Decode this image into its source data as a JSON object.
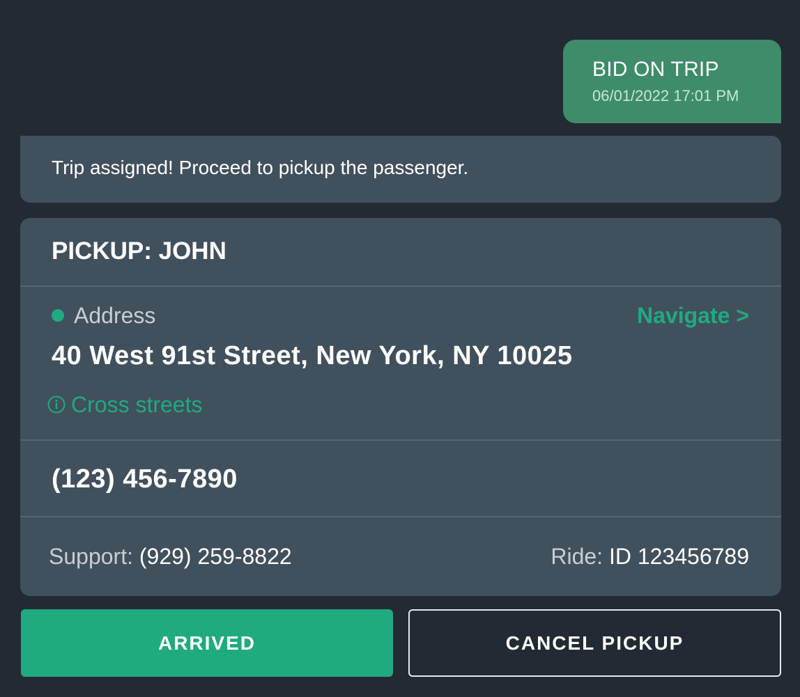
{
  "outgoing_message": {
    "title": "BID ON TRIP",
    "timestamp": "06/01/2022 17:01 PM"
  },
  "status_message": "Trip assigned! Proceed to pickup the passenger.",
  "pickup": {
    "title": "PICKUP: JOHN",
    "address_label": "Address",
    "navigate_label": "Navigate >",
    "address": "40 West 91st Street, New York, NY 10025",
    "cross_streets_label": "Cross streets",
    "phone": "(123) 456-7890",
    "support_label": "Support:",
    "support_phone": "(929) 259-8822",
    "ride_label": "Ride:",
    "ride_id": "ID 123456789"
  },
  "actions": {
    "arrived": "ARRIVED",
    "cancel": "CANCEL PICKUP"
  },
  "colors": {
    "background": "#232a34",
    "card": "#41505d",
    "accent": "#1faa80",
    "outgoing_bubble": "#3e8c6a"
  },
  "icons": {
    "address_marker": "dot-icon",
    "cross_streets": "info-icon"
  }
}
